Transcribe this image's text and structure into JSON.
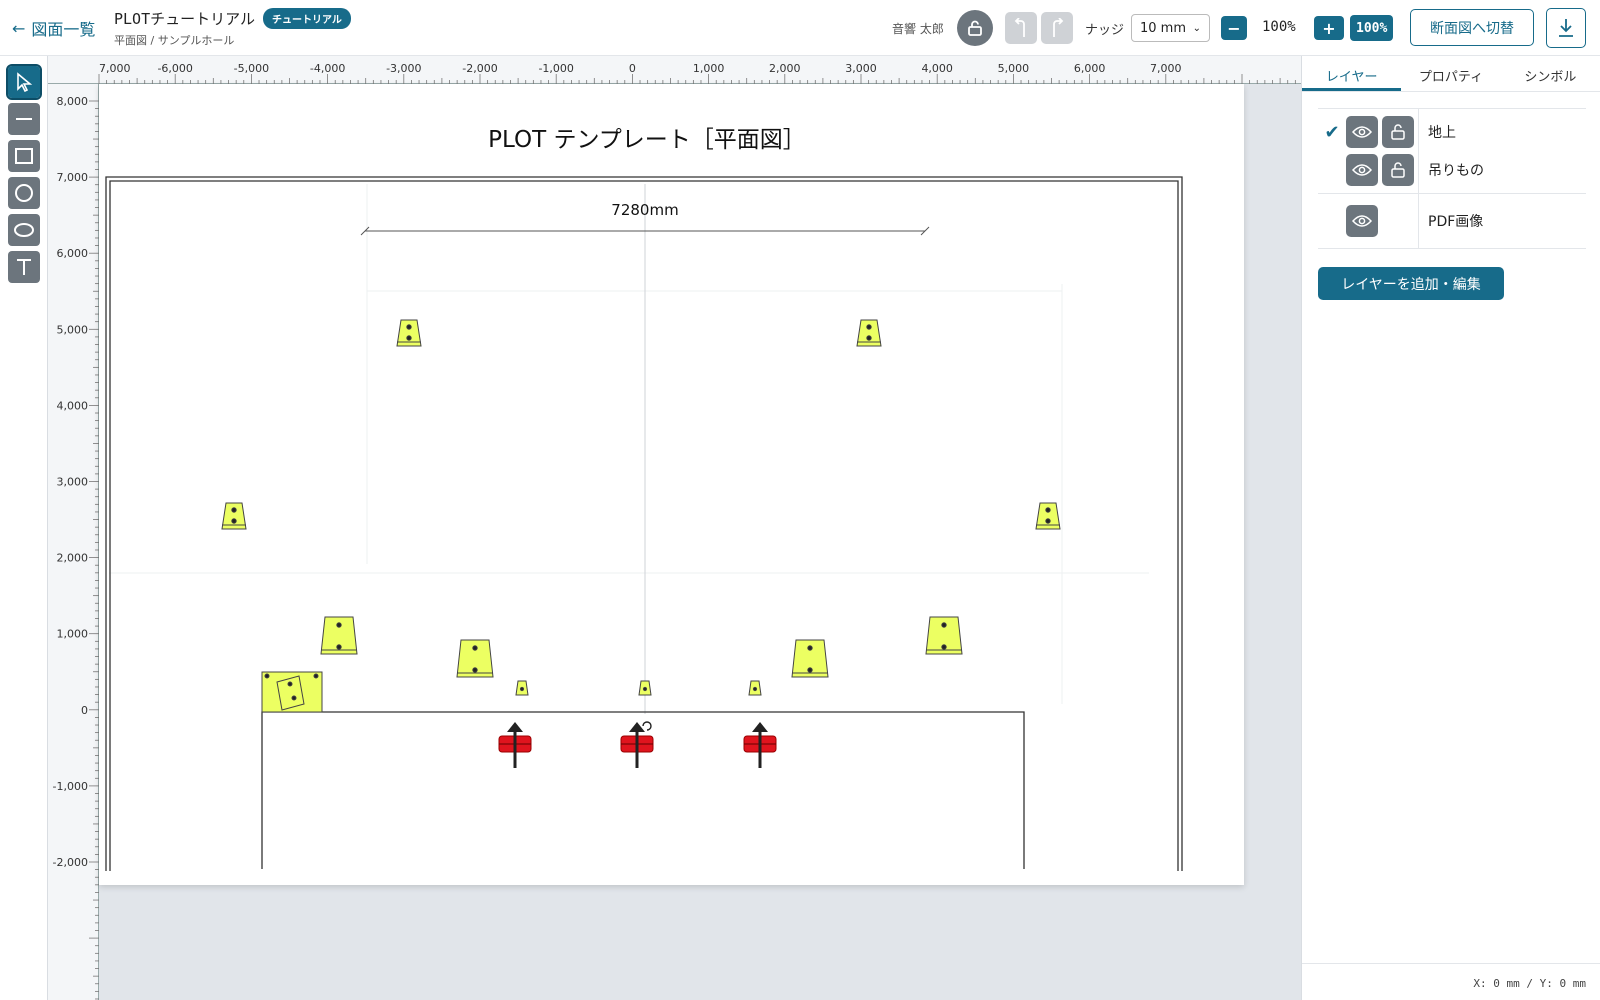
{
  "header": {
    "back_label": "図面一覧",
    "doc_title": "PLOTチュートリアル",
    "badge": "チュートリアル",
    "breadcrumb": "平面図 / サンプルホール",
    "user_name": "音響 太郎",
    "nudge_label": "ナッジ",
    "nudge_value": "10 mm",
    "zoom_minus": "−",
    "zoom_value": "100%",
    "zoom_plus": "+",
    "zoom_reset": "100%",
    "section_button": "断面図へ切替"
  },
  "toolbar": {
    "tools": [
      "select",
      "line",
      "rectangle",
      "circle",
      "ellipse",
      "text"
    ],
    "active": "select"
  },
  "canvas": {
    "drawing_title": "PLOT テンプレート［平面図］",
    "dimension_label": "7280mm",
    "hruler_labels": [
      "7,000",
      "-6,000",
      "-5,000",
      "-4,000",
      "-3,000",
      "-2,000",
      "-1,000",
      "0",
      "1,000",
      "2,000",
      "3,000",
      "4,000",
      "5,000",
      "6,000",
      "7,000"
    ],
    "vruler_labels": [
      "8,000",
      "7,000",
      "6,000",
      "5,000",
      "4,000",
      "3,000",
      "2,000",
      "1,000",
      "0",
      "-1,000",
      "-2,000"
    ]
  },
  "panel": {
    "tabs": [
      "レイヤー",
      "プロパティ",
      "シンボル"
    ],
    "active_tab": "レイヤー",
    "layers": [
      {
        "name": "地上",
        "checked": true,
        "locked": false
      },
      {
        "name": "吊りもの",
        "checked": false,
        "locked": false
      },
      {
        "name": "PDF画像",
        "checked": false
      }
    ],
    "add_layer_label": "レイヤーを追加・編集",
    "coords": "X: 0 mm / Y: 0 mm"
  },
  "colors": {
    "accent": "#176b8a",
    "speaker_fill": "#ecff62",
    "mic_red": "#e0141e"
  }
}
